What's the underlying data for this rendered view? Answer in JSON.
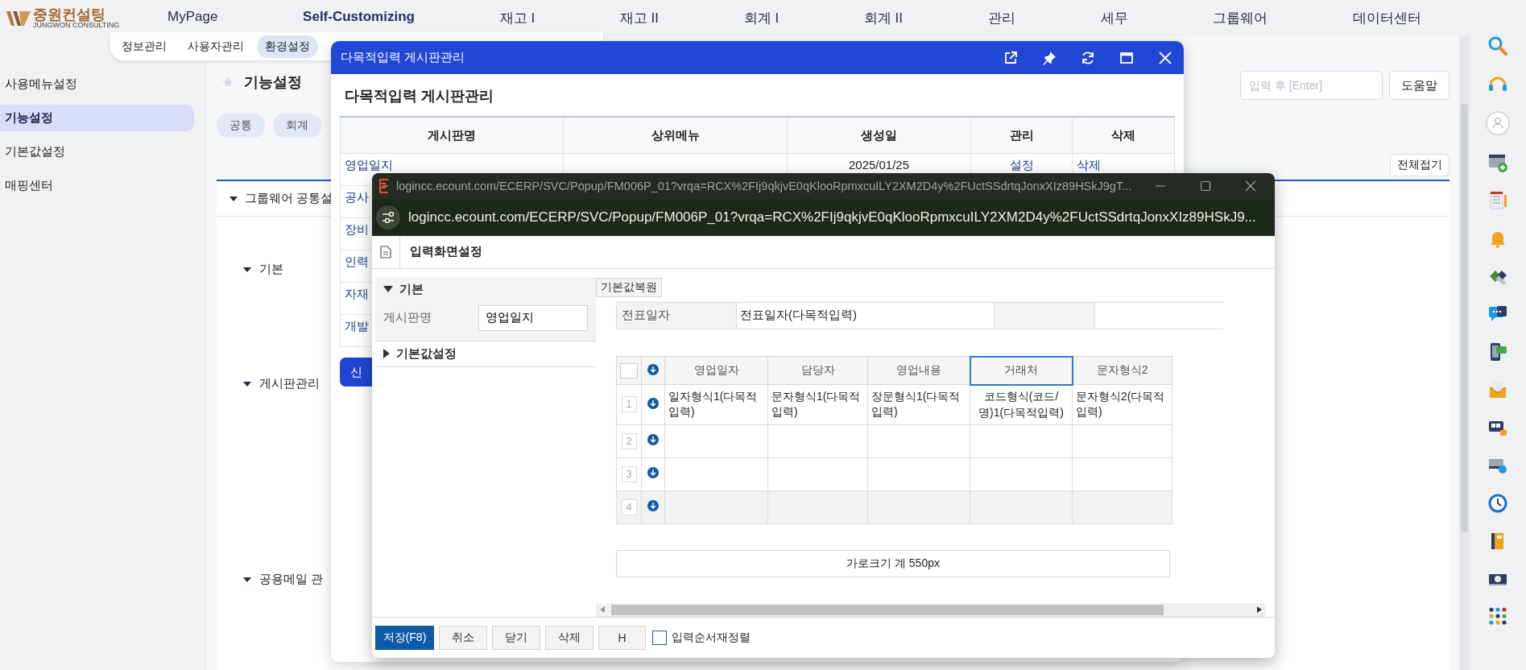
{
  "logo": {
    "name": "중원컨설팅",
    "tagline": "JUNGWON CONSULTING"
  },
  "nav": [
    {
      "label": "MyPage",
      "selected": false
    },
    {
      "label": "Self-Customizing",
      "selected": true
    },
    {
      "label": "재고 I",
      "selected": false
    },
    {
      "label": "재고 II",
      "selected": false
    },
    {
      "label": "회계 I",
      "selected": false
    },
    {
      "label": "회계 II",
      "selected": false
    },
    {
      "label": "관리",
      "selected": false
    },
    {
      "label": "세무",
      "selected": false
    },
    {
      "label": "그룹웨어",
      "selected": false
    },
    {
      "label": "데이터센터",
      "selected": false
    }
  ],
  "subnav": [
    {
      "label": "정보관리",
      "selected": false
    },
    {
      "label": "사용자관리",
      "selected": false
    },
    {
      "label": "환경설정",
      "selected": true
    }
  ],
  "sidebar": [
    {
      "label": "사용메뉴설정",
      "selected": false
    },
    {
      "label": "기능설정",
      "selected": true
    },
    {
      "label": "기본값설정",
      "selected": false
    },
    {
      "label": "매핑센터",
      "selected": false
    }
  ],
  "page": {
    "title": "기능설정",
    "tabs": [
      {
        "label": "공통"
      },
      {
        "label": "회계"
      }
    ],
    "search": {
      "placeholder": "입력 후 [Enter]"
    },
    "help_button": "도움말",
    "collapse_button": "전체접기",
    "sections": [
      {
        "label": "그룹웨어 공통설",
        "expanded": true,
        "children": [
          {
            "label": "기본",
            "expanded": true
          },
          {
            "label": "게시판관리",
            "expanded": true
          },
          {
            "label": "공용메일 관",
            "expanded": true
          }
        ]
      }
    ]
  },
  "modal": {
    "title": "다목적입력 게시판관리",
    "heading": "다목적입력 게시판관리",
    "columns": [
      "게시판명",
      "상위메뉴",
      "생성일",
      "관리",
      "삭제"
    ],
    "rows": [
      {
        "name": "영업일지",
        "created": "2025/01/25",
        "manage": "설정",
        "delete": "삭제"
      },
      {
        "name": "공사"
      },
      {
        "name": "장비"
      },
      {
        "name": "인력"
      },
      {
        "name": "자재"
      },
      {
        "name": "개발"
      }
    ],
    "new_button": "신"
  },
  "popup": {
    "title": "logincc.ecount.com/ECERP/SVC/Popup/FM006P_01?vrqa=RCX%2FIj9qkjvE0qKlooRpmxcuILY2XM2D4y%2FUctSSdrtqJonxXIz89HSkJ9gT...",
    "address": "logincc.ecount.com/ECERP/SVC/Popup/FM006P_01?vrqa=RCX%2FIj9qkjvE0qKlooRpmxcuILY2XM2D4y%2FUctSSdrtqJonxXIz89HSkJ9...",
    "heading": "입력화면설정",
    "sections": [
      {
        "label": "기본",
        "expanded": true,
        "fields": [
          {
            "label": "게시판명",
            "value": "영업일지"
          }
        ]
      },
      {
        "label": "기본값설정",
        "expanded": false
      }
    ],
    "restore_button": "기본값복원",
    "slip": {
      "label": "전표일자",
      "value": "전표일자(다목적입력)"
    },
    "grid": {
      "select_all_checked": false,
      "columns": [
        {
          "label": "영업일자",
          "selected": false
        },
        {
          "label": "담당자",
          "selected": false
        },
        {
          "label": "영업내용",
          "selected": false
        },
        {
          "label": "거래처",
          "selected": true
        },
        {
          "label": "문자형식2",
          "selected": false
        }
      ],
      "rows": [
        {
          "number": "1",
          "selected": false,
          "cells": [
            "일자형식1(다목적입력)",
            "문자형식1(다목적입력)",
            "장문형식1(다목적입력)",
            "코드형식(코드/명)1(다목적입력)",
            "문자형식2(다목적입력)"
          ]
        },
        {
          "number": "2",
          "selected": false
        },
        {
          "number": "3",
          "selected": false
        },
        {
          "number": "4",
          "selected": true
        }
      ]
    },
    "width_total": "가로크기 계 550px",
    "buttons": [
      {
        "label": "저장(F8)",
        "kind": "primary"
      },
      {
        "label": "취소",
        "kind": "default"
      },
      {
        "label": "닫기",
        "kind": "default"
      },
      {
        "label": "삭제",
        "kind": "default"
      },
      {
        "label": "H",
        "kind": "default"
      }
    ],
    "reorder": {
      "label": "입력순서재정렬",
      "checked": false
    }
  }
}
